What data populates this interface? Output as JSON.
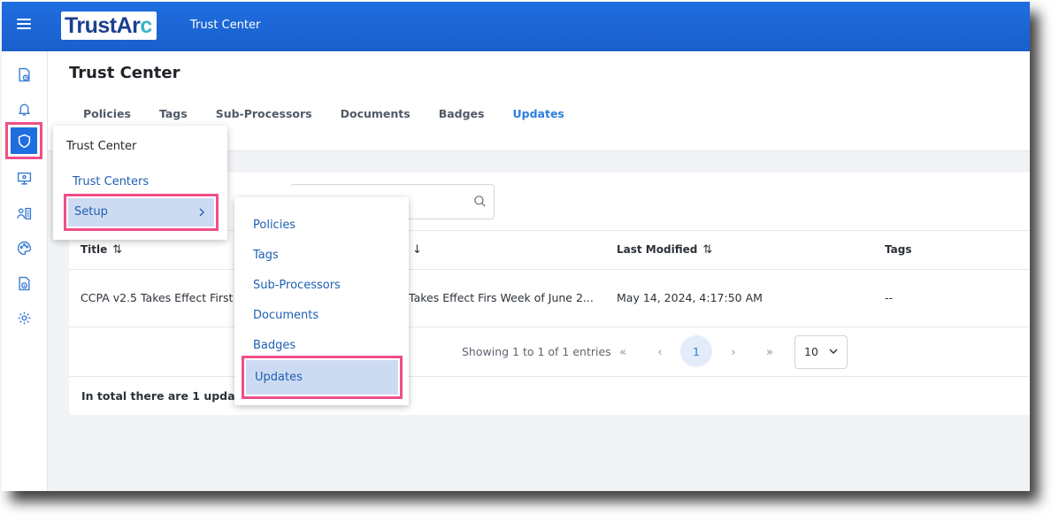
{
  "topbar": {
    "logo_part1": "TrustAr",
    "logo_part2": "c",
    "app_name": "Trust Center"
  },
  "sidebar": {
    "icons": [
      "document-clock-icon",
      "bell-icon",
      "shield-icon",
      "monitor-icon",
      "people-list-icon",
      "palette-icon",
      "document-info-icon",
      "gear-icon"
    ],
    "active_icon": "shield-icon"
  },
  "page": {
    "title": "Trust Center",
    "tabs": [
      {
        "label": "Policies",
        "active": false
      },
      {
        "label": "Tags",
        "active": false
      },
      {
        "label": "Sub-Processors",
        "active": false
      },
      {
        "label": "Documents",
        "active": false
      },
      {
        "label": "Badges",
        "active": false
      },
      {
        "label": "Updates",
        "active": true
      }
    ]
  },
  "table": {
    "columns": [
      "Title",
      "",
      "Last Modified",
      "Tags"
    ],
    "rows": [
      {
        "title": "CCPA v2.5 Takes Effect First",
        "description": "Takes Effect Firs Week of June 2...",
        "last_modified": "May 14, 2024, 4:17:50 AM",
        "tags": "--"
      }
    ],
    "pagination": {
      "showing": "Showing 1 to 1 of 1 entries",
      "first": "«",
      "prev": "‹",
      "current_page": "1",
      "next": "›",
      "last": "»",
      "per_page": "10"
    },
    "total_text": "In total there are 1 updates."
  },
  "menu_level1": {
    "title": "Trust Center",
    "items": [
      "Trust Centers",
      "Setup"
    ],
    "highlighted": "Setup"
  },
  "menu_level2": {
    "items": [
      "Policies",
      "Tags",
      "Sub-Processors",
      "Documents",
      "Badges",
      "Updates"
    ],
    "highlighted": "Updates"
  },
  "colors": {
    "topbar": "#1f6ee0",
    "accent": "#2a7de1",
    "highlight_border": "#ef4e8a",
    "menu_selected_bg": "#cddbf2"
  }
}
